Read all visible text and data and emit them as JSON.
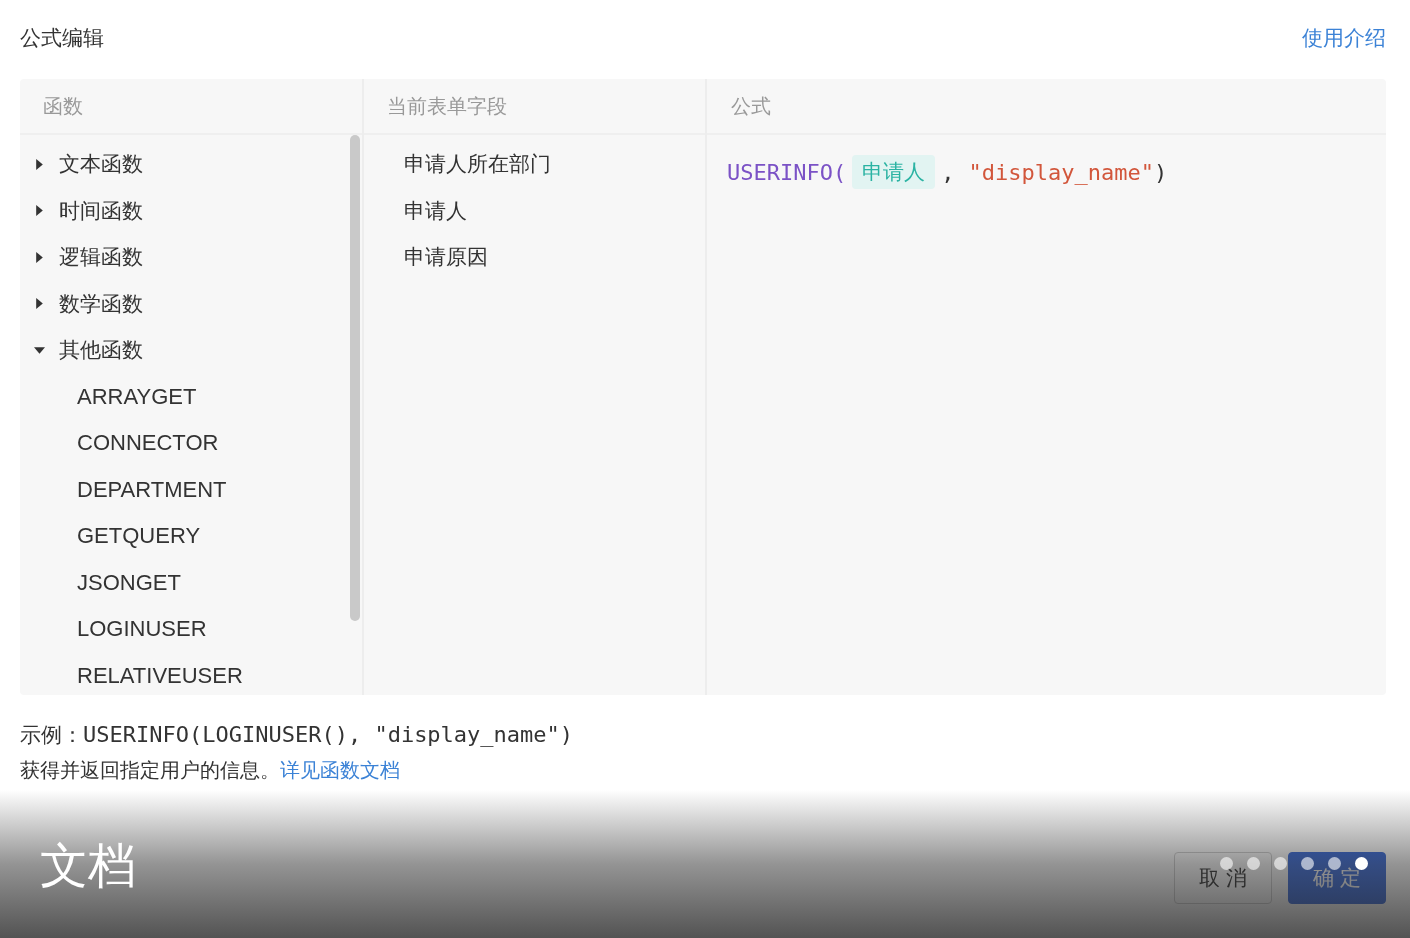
{
  "dialog": {
    "title": "公式编辑",
    "help_link": "使用介绍"
  },
  "columns": [
    "函数",
    "当前表单字段",
    "公式"
  ],
  "functions": [
    {
      "label": "文本函数",
      "expanded": false
    },
    {
      "label": "时间函数",
      "expanded": false
    },
    {
      "label": "逻辑函数",
      "expanded": false
    },
    {
      "label": "数学函数",
      "expanded": false
    },
    {
      "label": "其他函数",
      "expanded": true,
      "children": [
        {
          "label": "ARRAYGET"
        },
        {
          "label": "CONNECTOR"
        },
        {
          "label": "DEPARTMENT"
        },
        {
          "label": "GETQUERY"
        },
        {
          "label": "JSONGET"
        },
        {
          "label": "LOGINUSER"
        },
        {
          "label": "RELATIVEUSER"
        }
      ]
    }
  ],
  "fields": [
    "申请人所在部门",
    "申请人",
    "申请原因"
  ],
  "formula": [
    {
      "kind": "function",
      "text": "USERINFO("
    },
    {
      "kind": "field",
      "text": "申请人"
    },
    {
      "kind": "punct",
      "text": ","
    },
    {
      "kind": "string",
      "text": "\"display_name\""
    },
    {
      "kind": "punct",
      "text": ")"
    }
  ],
  "example": {
    "label": "示例：",
    "code": "USERINFO(LOGINUSER(), \"display_name\")"
  },
  "description": {
    "text": "获得并返回指定用户的信息。",
    "link": "详见函数文档"
  },
  "buttons": [
    {
      "label": "取 消",
      "kind": "default"
    },
    {
      "label": "确 定",
      "kind": "primary"
    }
  ],
  "caption": "文档",
  "pager": [
    {
      "selected": false
    },
    {
      "selected": false
    },
    {
      "selected": false
    },
    {
      "selected": false
    },
    {
      "selected": false
    },
    {
      "selected": true
    }
  ]
}
